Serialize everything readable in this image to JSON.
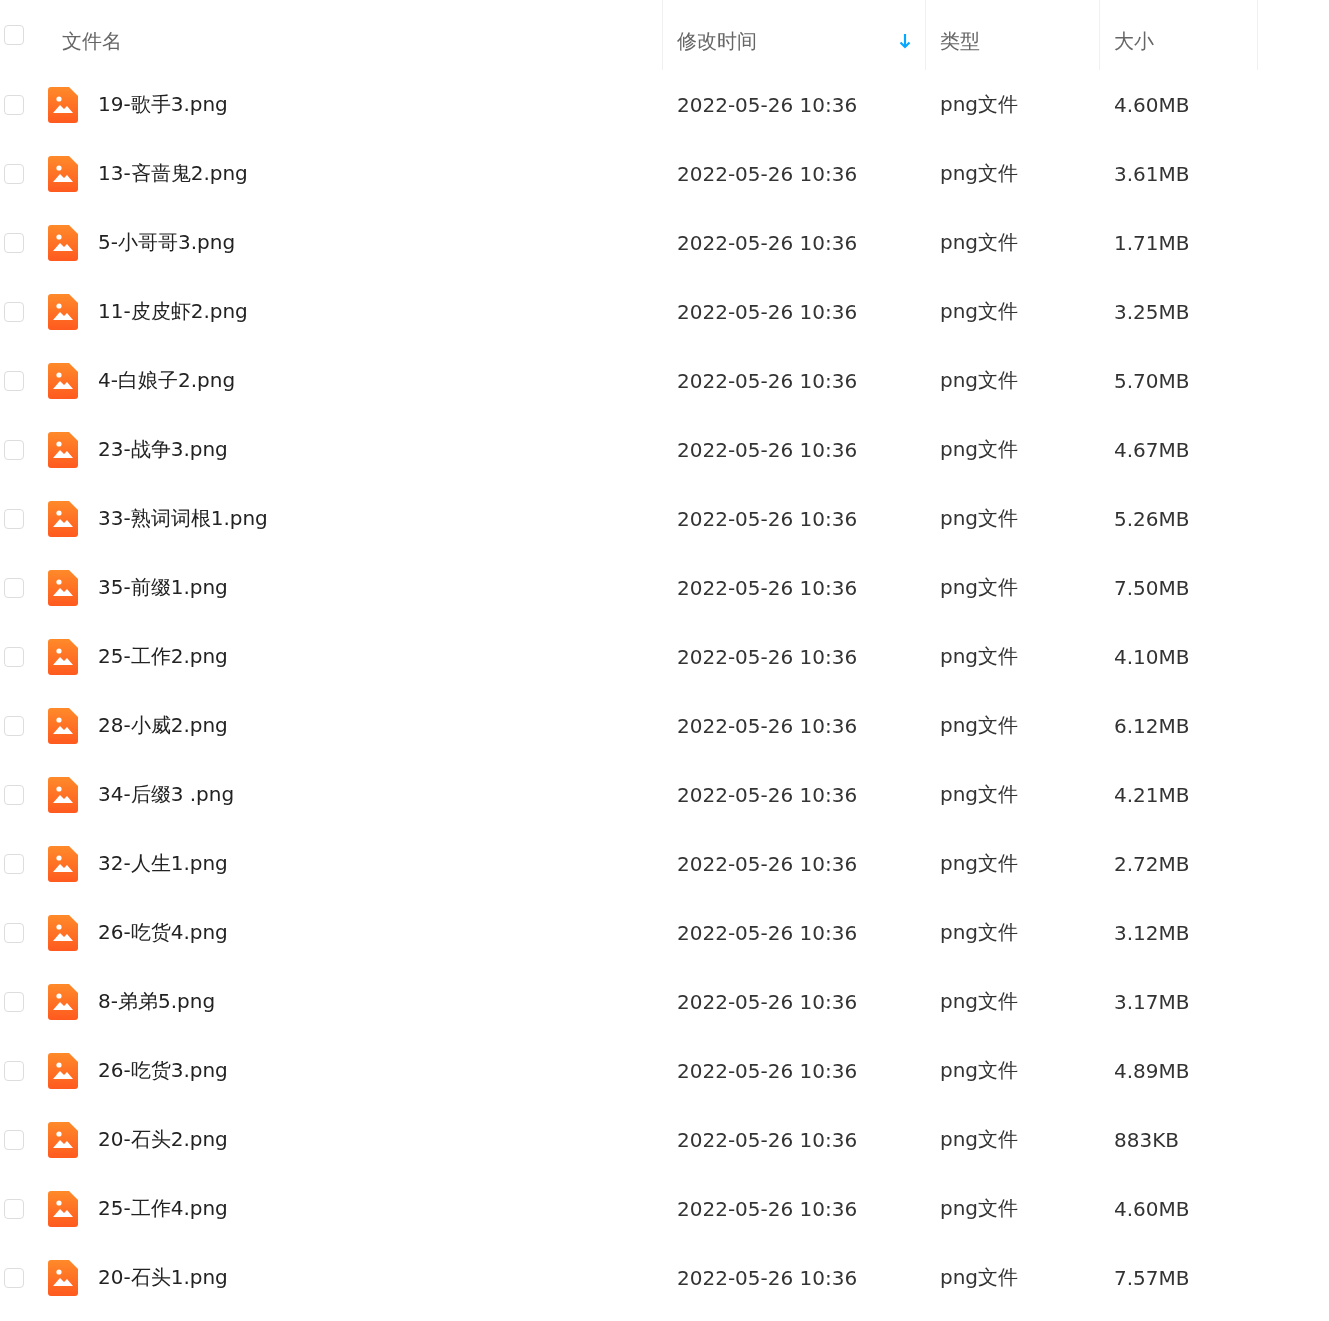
{
  "header": {
    "checked": false,
    "columns": [
      {
        "label": "文件名",
        "sorted": false
      },
      {
        "label": "修改时间",
        "sorted": true
      },
      {
        "label": "类型",
        "sorted": false
      },
      {
        "label": "大小",
        "sorted": false
      }
    ]
  },
  "rows": [
    {
      "name": "19-歌手3.png",
      "modified": "2022-05-26 10:36",
      "type": "png文件",
      "size": "4.60MB",
      "checked": false
    },
    {
      "name": "13-吝啬鬼2.png",
      "modified": "2022-05-26 10:36",
      "type": "png文件",
      "size": "3.61MB",
      "checked": false
    },
    {
      "name": "5-小哥哥3.png",
      "modified": "2022-05-26 10:36",
      "type": "png文件",
      "size": "1.71MB",
      "checked": false
    },
    {
      "name": "11-皮皮虾2.png",
      "modified": "2022-05-26 10:36",
      "type": "png文件",
      "size": "3.25MB",
      "checked": false
    },
    {
      "name": "4-白娘子2.png",
      "modified": "2022-05-26 10:36",
      "type": "png文件",
      "size": "5.70MB",
      "checked": false
    },
    {
      "name": "23-战争3.png",
      "modified": "2022-05-26 10:36",
      "type": "png文件",
      "size": "4.67MB",
      "checked": false
    },
    {
      "name": "33-熟词词根1.png",
      "modified": "2022-05-26 10:36",
      "type": "png文件",
      "size": "5.26MB",
      "checked": false
    },
    {
      "name": "35-前缀1.png",
      "modified": "2022-05-26 10:36",
      "type": "png文件",
      "size": "7.50MB",
      "checked": false
    },
    {
      "name": "25-工作2.png",
      "modified": "2022-05-26 10:36",
      "type": "png文件",
      "size": "4.10MB",
      "checked": false
    },
    {
      "name": "28-小威2.png",
      "modified": "2022-05-26 10:36",
      "type": "png文件",
      "size": "6.12MB",
      "checked": false
    },
    {
      "name": "34-后缀3 .png",
      "modified": "2022-05-26 10:36",
      "type": "png文件",
      "size": "4.21MB",
      "checked": false
    },
    {
      "name": "32-人生1.png",
      "modified": "2022-05-26 10:36",
      "type": "png文件",
      "size": "2.72MB",
      "checked": false
    },
    {
      "name": "26-吃货4.png",
      "modified": "2022-05-26 10:36",
      "type": "png文件",
      "size": "3.12MB",
      "checked": false
    },
    {
      "name": "8-弟弟5.png",
      "modified": "2022-05-26 10:36",
      "type": "png文件",
      "size": "3.17MB",
      "checked": false
    },
    {
      "name": "26-吃货3.png",
      "modified": "2022-05-26 10:36",
      "type": "png文件",
      "size": "4.89MB",
      "checked": false
    },
    {
      "name": "20-石头2.png",
      "modified": "2022-05-26 10:36",
      "type": "png文件",
      "size": "883KB",
      "checked": false
    },
    {
      "name": "25-工作4.png",
      "modified": "2022-05-26 10:36",
      "type": "png文件",
      "size": "4.60MB",
      "checked": false
    },
    {
      "name": "20-石头1.png",
      "modified": "2022-05-26 10:36",
      "type": "png文件",
      "size": "7.57MB",
      "checked": false
    }
  ]
}
